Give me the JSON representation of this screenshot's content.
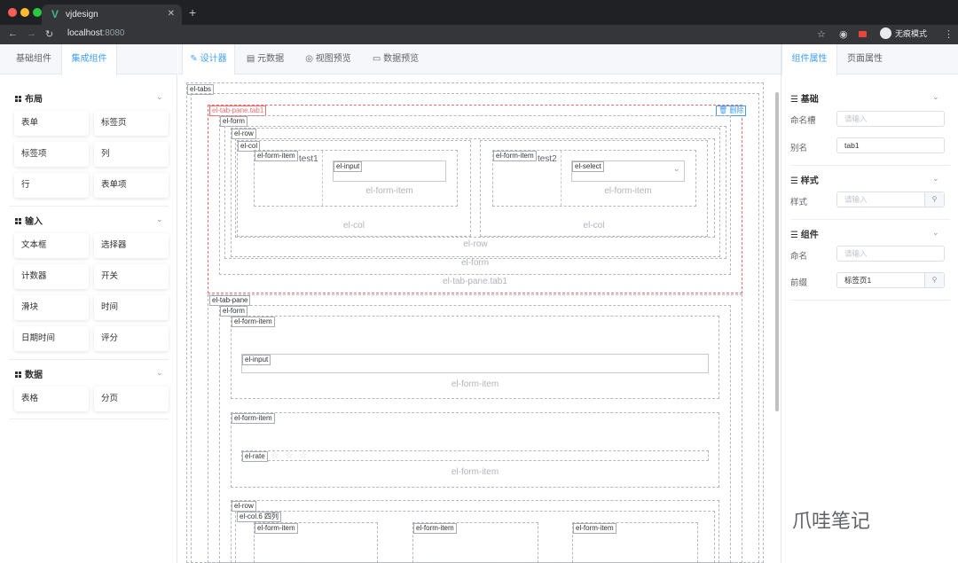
{
  "browser": {
    "tab_title": "vjdesign",
    "url_host": "localhost",
    "url_port": ":8080",
    "incognito_label": "无痕模式",
    "colors": {
      "titlebar": "#202124",
      "toolbar": "#35363a",
      "vue_green": "#41b883"
    }
  },
  "left_panel": {
    "tabs": [
      "基础组件",
      "集成组件"
    ],
    "active_tab": "集成组件",
    "sections": [
      {
        "title": "布局",
        "items": [
          "表单",
          "标签页",
          "标签项",
          "列",
          "行",
          "表单项"
        ]
      },
      {
        "title": "输入",
        "items": [
          "文本框",
          "选择器",
          "计数器",
          "开关",
          "滑块",
          "时间",
          "日期时间",
          "评分"
        ]
      },
      {
        "title": "数据",
        "items": [
          "表格",
          "分页"
        ]
      }
    ]
  },
  "center_panel": {
    "tabs": [
      {
        "label": "设计器",
        "icon": "edit-icon"
      },
      {
        "label": "元数据",
        "icon": "file-icon"
      },
      {
        "label": "视图预览",
        "icon": "eye-icon"
      },
      {
        "label": "数据预览",
        "icon": "data-icon"
      }
    ],
    "active_tab": "设计器",
    "labels": {
      "tabs": "el-tabs",
      "pane1": "el-tab-pane.tab1",
      "delete": "删除",
      "form": "el-form",
      "row": "el-row",
      "col": "el-col",
      "form_item": "el-form-item",
      "input": "el-input",
      "select": "el-select",
      "pane2": "el-tab-pane",
      "rate": "el-rate",
      "col_quarter": "el-col.6 四列",
      "test1": "test1",
      "test2": "test2"
    },
    "colors": {
      "selected": "#f56c6c",
      "delete_btn": "#409eff"
    }
  },
  "right_panel": {
    "tabs": [
      "组件属性",
      "页面属性"
    ],
    "active_tab": "组件属性",
    "sections": [
      {
        "title": "基础",
        "fields": [
          {
            "label": "命名槽",
            "value": "",
            "placeholder": "请输入"
          },
          {
            "label": "别名",
            "value": "tab1",
            "placeholder": ""
          }
        ]
      },
      {
        "title": "样式",
        "fields": [
          {
            "label": "样式",
            "value": "",
            "placeholder": "请输入"
          }
        ]
      },
      {
        "title": "组件",
        "fields": [
          {
            "label": "命名",
            "value": "",
            "placeholder": "请输入"
          },
          {
            "label": "前缀",
            "value": "标签页1",
            "placeholder": ""
          }
        ]
      }
    ],
    "accent": "#409eff"
  },
  "watermark": "爪哇笔记"
}
